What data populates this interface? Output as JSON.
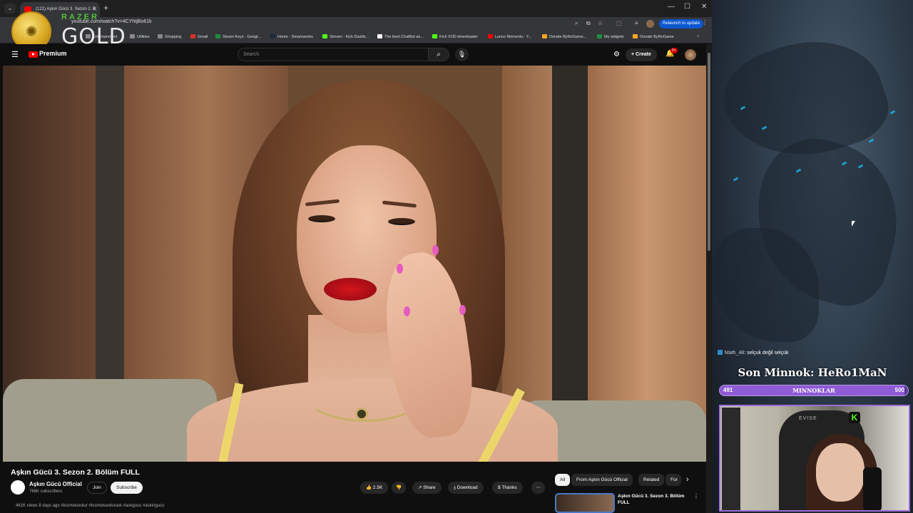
{
  "browser": {
    "tab_title": "(121) Aşkın Gücü 3. Sezon 2. B",
    "url": "youtube.com/watch?v=4CYhtjBo61k",
    "relaunch_label": "Relaunch to update",
    "bookmarks": [
      {
        "label": "Entertainment",
        "color": "#888888"
      },
      {
        "label": "Utilities",
        "color": "#888888"
      },
      {
        "label": "Shopping",
        "color": "#888888"
      },
      {
        "label": "Gmail",
        "color": "#d93025"
      },
      {
        "label": "Steam Keys - Googl...",
        "color": "#1e8e3e"
      },
      {
        "label": "Home - Steamworks",
        "color": "#1b2838"
      },
      {
        "label": "Stream - Kick Dashb...",
        "color": "#53fc18"
      },
      {
        "label": "The best ChatBot an...",
        "color": "#ffffff"
      },
      {
        "label": "Kick VOD downloader",
        "color": "#53fc18"
      },
      {
        "label": "Lunox Moments - Y...",
        "color": "#ff0000"
      },
      {
        "label": "Donate ByNoGame...",
        "color": "#f5a623"
      },
      {
        "label": "My widgets",
        "color": "#1e8e3e"
      },
      {
        "label": "Donate ByNoGame",
        "color": "#f5a623"
      }
    ]
  },
  "razer_overlay": {
    "brand": "RAZER",
    "label": "GOLD"
  },
  "youtube": {
    "logo_label": "Premium",
    "search_placeholder": "Search",
    "create_label": "Create",
    "notification_count": "9+",
    "video_title": "Aşkın Gücü 3. Sezon 2. Bölüm FULL",
    "channel_name": "Aşkın Gücü Official",
    "channel_subs": "768K subscribers",
    "join_label": "Join",
    "subscribe_label": "Subscribe",
    "like_count": "2.5K",
    "share_label": "Share",
    "download_label": "Download",
    "thanks_label": "Thanks",
    "meta_line": "461K views  8 days ago  #kısmetseolur #kısmetseolurask #askgucu #askingucu",
    "chips": [
      "All",
      "From Aşkın Gücü Official",
      "Related",
      "For"
    ],
    "recommendation_title_line1": "Aşkın Gücü 3. Sezon 3. Bölüm",
    "recommendation_title_line2": "FULL"
  },
  "stream_overlay": {
    "chat_user": "Math_48",
    "chat_message": ": selçuk değil selçük",
    "last_subscriber": "Son Minnok: HeRo1MaN",
    "goal_label": "MINNOKLAR",
    "goal_current": "491",
    "goal_target": "500",
    "goal_progress_fraction": 0.982,
    "webcam_chair_brand": "EVISE",
    "accent_color": "#9c6ad6"
  }
}
